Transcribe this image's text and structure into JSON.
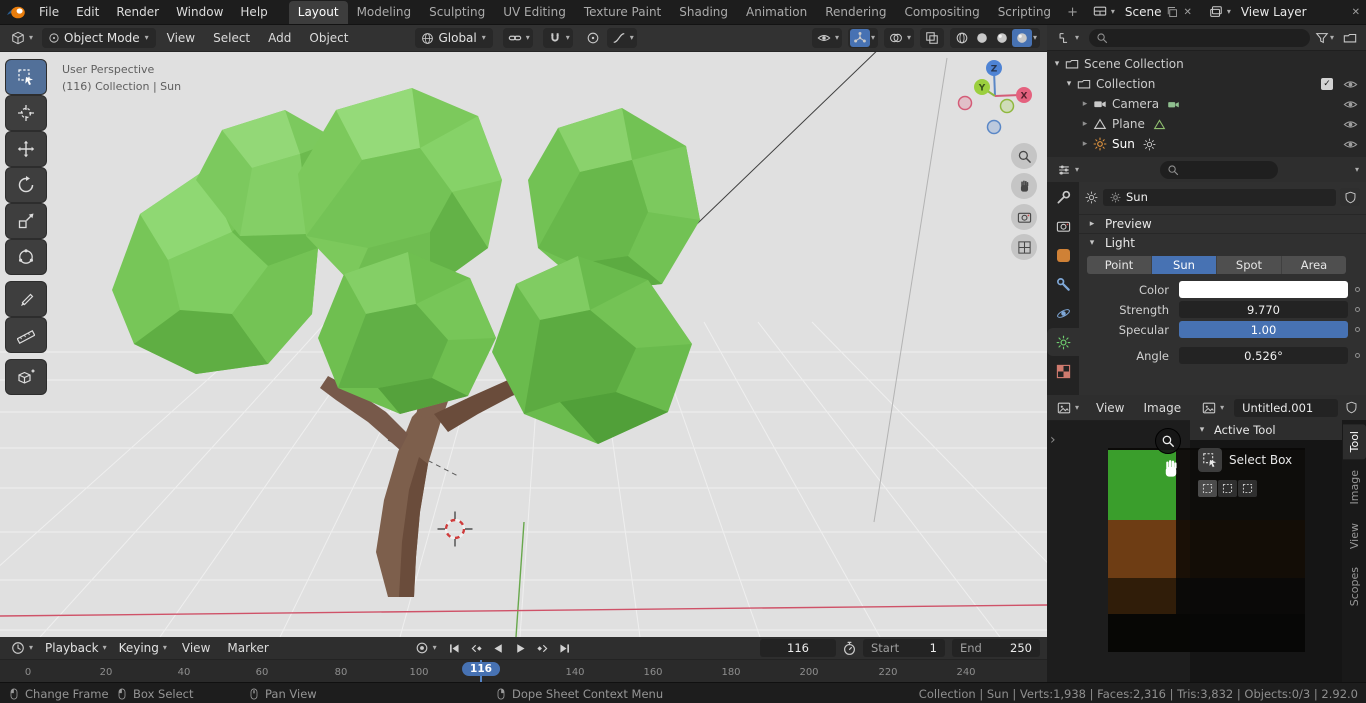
{
  "colors": {
    "accent": "#4772b3",
    "object_orange": "#cf8136",
    "light_data_green": "#6fcf6f",
    "viewport_bg": "#e0e0e0"
  },
  "icons": {
    "chevron_down": "▾",
    "caret_right": "▸",
    "caret_down": "▾",
    "check": "✓",
    "close": "✕",
    "plus": "+",
    "expand_arrow": "›"
  },
  "topbar": {
    "menus": [
      "File",
      "Edit",
      "Render",
      "Window",
      "Help"
    ],
    "workspaces": [
      "Layout",
      "Modeling",
      "Sculpting",
      "UV Editing",
      "Texture Paint",
      "Shading",
      "Animation",
      "Rendering",
      "Compositing",
      "Scripting"
    ],
    "active_workspace": "Layout",
    "scene_name": "Scene",
    "view_layer_name": "View Layer"
  },
  "viewport": {
    "mode": "Object Mode",
    "menus": [
      "View",
      "Select",
      "Add",
      "Object"
    ],
    "orientation": "Global",
    "overlay_line1": "User Perspective",
    "overlay_line2": "(116) Collection | Sun",
    "axis_x": "X",
    "axis_y": "Y",
    "axis_z": "Z"
  },
  "outliner": {
    "rows": [
      {
        "label": "Scene Collection"
      },
      {
        "label": "Collection"
      },
      {
        "label": "Camera"
      },
      {
        "label": "Plane"
      },
      {
        "label": "Sun"
      }
    ]
  },
  "properties": {
    "datablock_name": "Sun",
    "preview_panel": "Preview",
    "light_panel": "Light",
    "light_types": [
      "Point",
      "Sun",
      "Spot",
      "Area"
    ],
    "active_light_type": "Sun",
    "color_label": "Color",
    "strength_label": "Strength",
    "strength_value": "9.770",
    "specular_label": "Specular",
    "specular_value": "1.00",
    "angle_label": "Angle",
    "angle_value": "0.526°"
  },
  "image_editor": {
    "menus": [
      "View",
      "Image"
    ],
    "image_name": "Untitled.001",
    "panel_title": "Active Tool",
    "tool_name": "Select Box",
    "side_tabs": [
      "Tool",
      "Image",
      "View",
      "Scopes"
    ]
  },
  "timeline": {
    "menus": [
      "Playback",
      "Keying",
      "View",
      "Marker"
    ],
    "frame_value": "116",
    "playhead_label": "116",
    "start_label": "Start",
    "start_value": "1",
    "end_label": "End",
    "end_value": "250",
    "ticks": [
      "0",
      "20",
      "40",
      "60",
      "80",
      "100",
      "140",
      "160",
      "180",
      "200",
      "220",
      "240"
    ]
  },
  "statusbar": {
    "hints": [
      {
        "label": "Change Frame"
      },
      {
        "label": "Box Select"
      },
      {
        "label": "Pan View"
      },
      {
        "label": "Dope Sheet Context Menu"
      }
    ],
    "stats": "Collection | Sun | Verts:1,938 | Faces:2,316 | Tris:3,832 | Objects:0/3 | 2.92.0"
  }
}
